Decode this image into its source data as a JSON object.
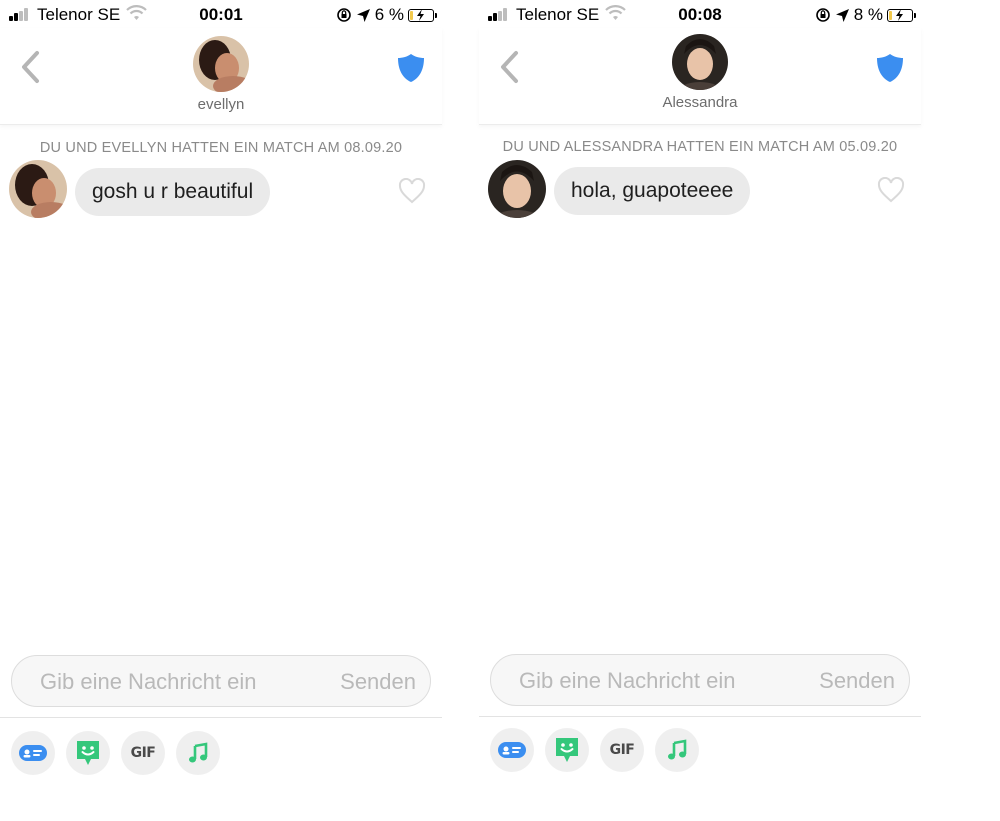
{
  "screens": [
    {
      "status": {
        "carrier": "Telenor SE",
        "time": "00:01",
        "battery": "6 %",
        "battery_level": 0.06
      },
      "header": {
        "back_icon": "chevron-left-icon",
        "name": "evellyn",
        "shield_icon": "shield-icon"
      },
      "match_line": "DU UND EVELLYN HATTEN EIN MATCH AM 08.09.20",
      "message": {
        "text": "gosh u r beautiful",
        "like_icon": "heart-outline-icon"
      },
      "composer": {
        "placeholder": "Gib eine Nachricht ein",
        "send_label": "Senden"
      },
      "toolbar": {
        "gif_label": "GIF",
        "icons": [
          "contact-card-icon",
          "sticker-icon",
          "gif-icon",
          "music-note-icon"
        ]
      }
    },
    {
      "status": {
        "carrier": "Telenor SE",
        "time": "00:08",
        "battery": "8 %",
        "battery_level": 0.08
      },
      "header": {
        "back_icon": "chevron-left-icon",
        "name": "Alessandra",
        "shield_icon": "shield-icon"
      },
      "match_line": "DU UND ALESSANDRA HATTEN EIN MATCH AM 05.09.20",
      "message": {
        "text": "hola, guapoteeee",
        "like_icon": "heart-outline-icon"
      },
      "composer": {
        "placeholder": "Gib eine Nachricht ein",
        "send_label": "Senden"
      },
      "toolbar": {
        "gif_label": "GIF",
        "icons": [
          "contact-card-icon",
          "sticker-icon",
          "gif-icon",
          "music-note-icon"
        ]
      }
    }
  ],
  "colors": {
    "accent_blue": "#3b8ef0",
    "sticker_green": "#34c77b",
    "bubble_gray": "#eaeaea",
    "battery_yellow": "#f2c94c"
  }
}
